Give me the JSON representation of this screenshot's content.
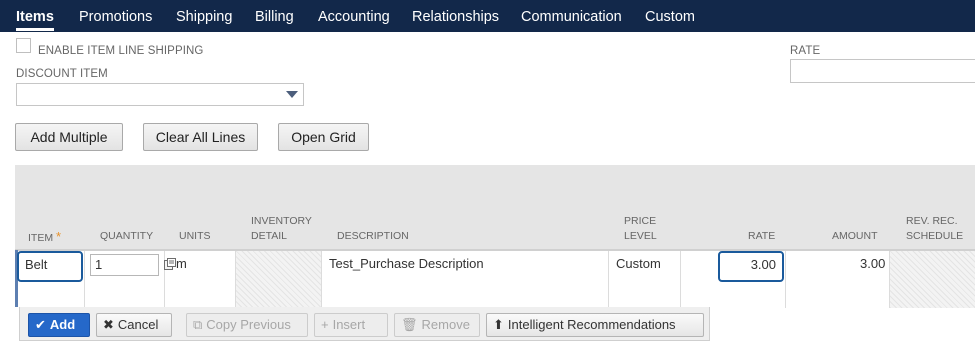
{
  "tabs": [
    {
      "label": "Items",
      "active": true
    },
    {
      "label": "Promotions",
      "active": false
    },
    {
      "label": "Shipping",
      "active": false
    },
    {
      "label": "Billing",
      "active": false
    },
    {
      "label": "Accounting",
      "active": false
    },
    {
      "label": "Relationships",
      "active": false
    },
    {
      "label": "Communication",
      "active": false
    },
    {
      "label": "Custom",
      "active": false
    }
  ],
  "form": {
    "enable_item_line_shipping_label": "ENABLE ITEM LINE SHIPPING",
    "enable_item_line_shipping_checked": false,
    "discount_item_label": "DISCOUNT ITEM",
    "discount_item_value": "",
    "rate_label": "RATE",
    "rate_value": ""
  },
  "actions": {
    "add_multiple": "Add Multiple",
    "clear_all_lines": "Clear All Lines",
    "open_grid": "Open Grid"
  },
  "grid": {
    "columns": {
      "item": "ITEM",
      "item_required": "*",
      "quantity": "QUANTITY",
      "units": "UNITS",
      "inventory_detail_1": "INVENTORY",
      "inventory_detail_2": "DETAIL",
      "description": "DESCRIPTION",
      "price_level_1": "PRICE",
      "price_level_2": "LEVEL",
      "rate": "RATE",
      "amount": "AMOUNT",
      "rev_rec_1": "REV. REC.",
      "rev_rec_2": "SCHEDULE"
    },
    "row": {
      "item": "Belt",
      "quantity": "1",
      "units": "m",
      "description": "Test_Purchase Description",
      "price_level": "Custom",
      "rate": "3.00",
      "amount": "3.00"
    }
  },
  "row_actions": {
    "add": "Add",
    "cancel": "Cancel",
    "copy_previous": "Copy Previous",
    "insert": "Insert",
    "remove": "Remove",
    "intelligent_recommendations": "Intelligent Recommendations"
  },
  "colors": {
    "tabbar": "#12284a",
    "primary_button": "#2568c9",
    "highlight_border": "#1a5a9c",
    "required_star": "#e8922b"
  }
}
